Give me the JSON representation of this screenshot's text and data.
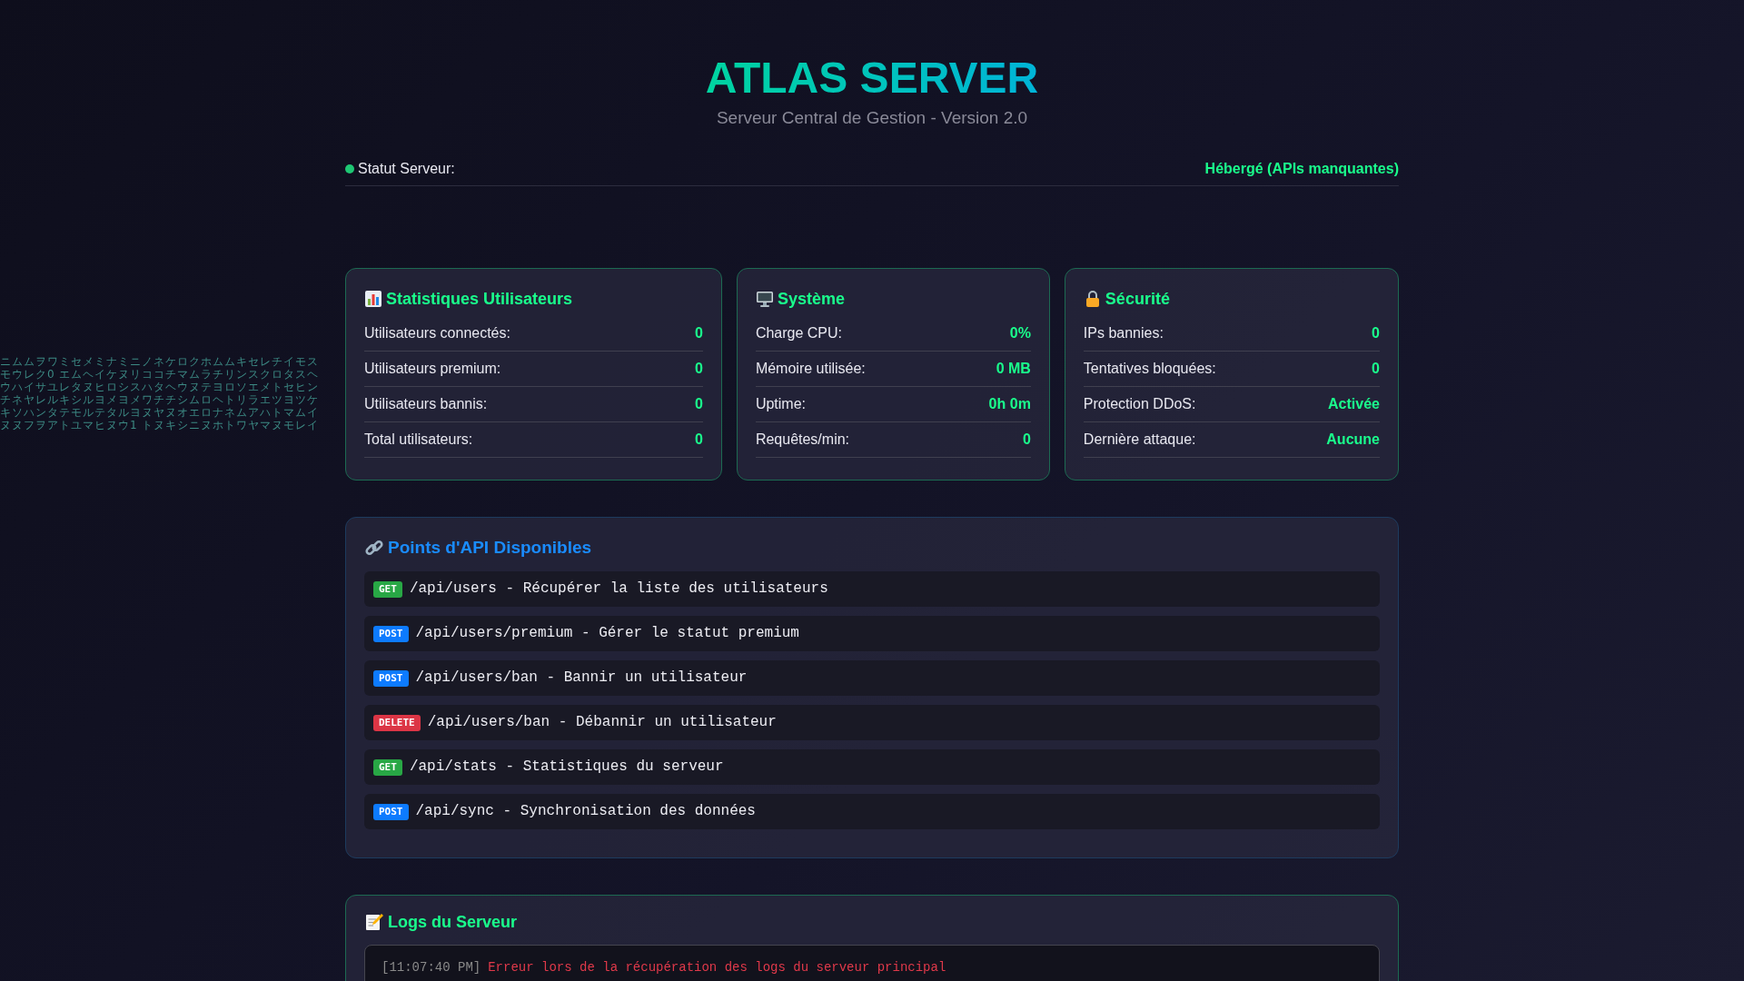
{
  "header": {
    "title": "ATLAS SERVER",
    "subtitle": "Serveur Central de Gestion - Version 2.0"
  },
  "status": {
    "label": "Statut Serveur:",
    "value": "Hébergé (APIs manquantes)"
  },
  "matrix_rain": [
    "ニムムヲワミセメミナミニノネケロクホムムキセレチイモス",
    "モウレク0 エムヘイケヌリココチマムラチリンスクロタスヘ",
    "ウハイサユレタヌヒロシスハタヘウヌテヨロソエメトセヒン",
    "チネヤレルキシルヨメヨメワチチシムロヘトリラエツヨツケ",
    "キソハンタテモルテタルヨヌヤヌオエロナネムアハトマムイ",
    "ヌヌフヲアトユマヒヌウ1 トヌキシニヌホトワヤマヌモレイ"
  ],
  "stat_cards": [
    {
      "kind": "chart",
      "title": "Statistiques Utilisateurs",
      "rows": [
        {
          "label": "Utilisateurs connectés:",
          "value": "0"
        },
        {
          "label": "Utilisateurs premium:",
          "value": "0"
        },
        {
          "label": "Utilisateurs bannis:",
          "value": "0"
        },
        {
          "label": "Total utilisateurs:",
          "value": "0"
        }
      ]
    },
    {
      "kind": "monitor",
      "title": "Système",
      "rows": [
        {
          "label": "Charge CPU:",
          "value": "0%"
        },
        {
          "label": "Mémoire utilisée:",
          "value": "0 MB"
        },
        {
          "label": "Uptime:",
          "value": "0h 0m"
        },
        {
          "label": "Requêtes/min:",
          "value": "0"
        }
      ]
    },
    {
      "kind": "lock",
      "title": "Sécurité",
      "rows": [
        {
          "label": "IPs bannies:",
          "value": "0"
        },
        {
          "label": "Tentatives bloquées:",
          "value": "0"
        },
        {
          "label": "Protection DDoS:",
          "value": "Activée"
        },
        {
          "label": "Dernière attaque:",
          "value": "Aucune"
        }
      ]
    }
  ],
  "api": {
    "title": "Points d'API Disponibles",
    "endpoints": [
      {
        "method": "GET",
        "text": "/api/users - Récupérer la liste des utilisateurs"
      },
      {
        "method": "POST",
        "text": "/api/users/premium - Gérer le statut premium"
      },
      {
        "method": "POST",
        "text": "/api/users/ban - Bannir un utilisateur"
      },
      {
        "method": "DELETE",
        "text": "/api/users/ban - Débannir un utilisateur"
      },
      {
        "method": "GET",
        "text": "/api/stats - Statistiques du serveur"
      },
      {
        "method": "POST",
        "text": "/api/sync - Synchronisation des données"
      }
    ]
  },
  "logs": {
    "title": "Logs du Serveur",
    "entries": [
      {
        "kind": "error",
        "time": "[11:07:40 PM]",
        "message": "Erreur lors de la récupération des logs du serveur principal"
      }
    ]
  }
}
